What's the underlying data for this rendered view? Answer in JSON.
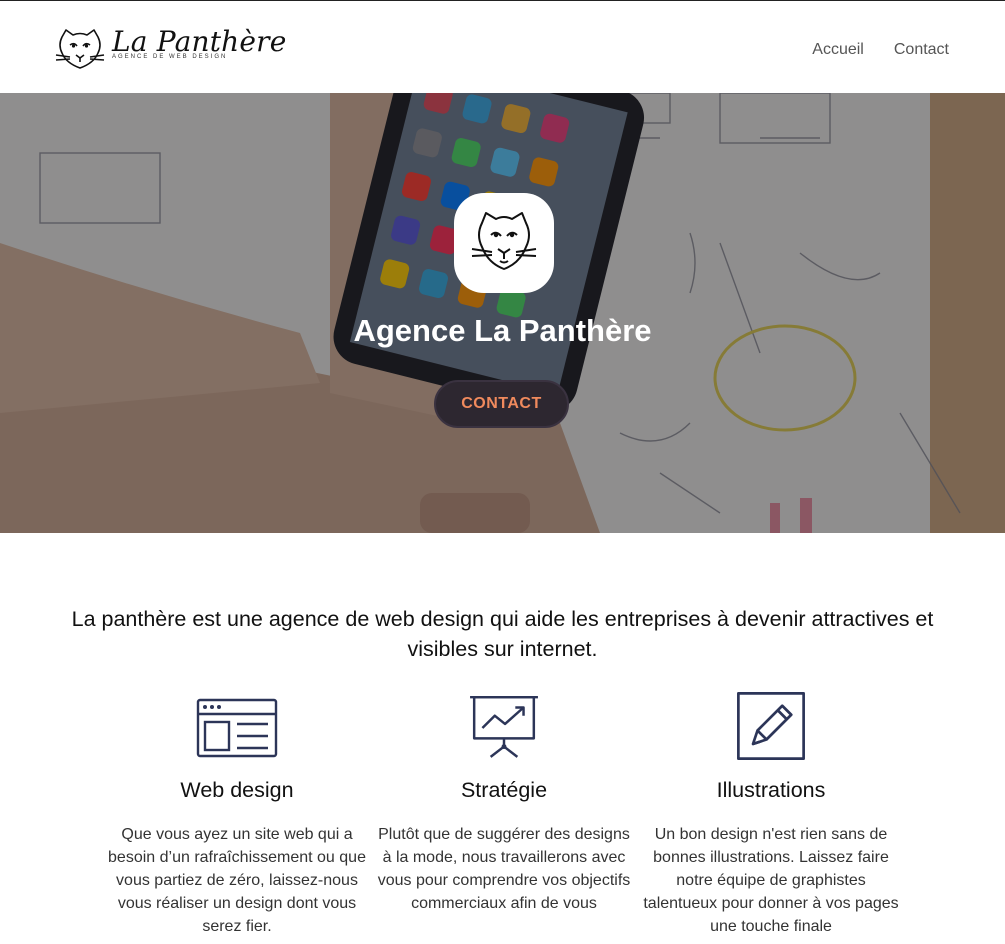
{
  "brand": {
    "name": "La Panthère",
    "tagline": "AGENCE DE WEB DESIGN",
    "logo_icon": "panther-head-icon"
  },
  "nav": {
    "items": [
      {
        "label": "Accueil"
      },
      {
        "label": "Contact"
      }
    ]
  },
  "hero": {
    "badge_icon": "panther-head-icon",
    "title": "Agence La Panthère",
    "button_label": "CONTACT",
    "button_text_color": "#f08a5d",
    "background": "photo-of-hand-with-smartphone-on-sketches"
  },
  "intro": {
    "text": "La panthère est une agence de web design qui aide les entreprises à devenir attractives et visibles sur internet."
  },
  "features": [
    {
      "icon": "browser-window-icon",
      "title": "Web design",
      "text": "Que vous ayez un site web qui a besoin d’un rafraîchissement ou que vous partiez de zéro, laissez-nous vous réaliser un design dont vous serez fier."
    },
    {
      "icon": "presentation-chart-icon",
      "title": "Stratégie",
      "text": "Plutôt que de suggérer des designs à la mode, nous travaillerons avec vous pour comprendre vos objectifs commerciaux afin de vous"
    },
    {
      "icon": "edit-pencil-icon",
      "title": "Illustrations",
      "text": "Un bon design n'est rien sans de bonnes illustrations. Laissez faire notre équipe de graphistes talentueux pour donner à vos pages une touche finale"
    }
  ],
  "colors": {
    "icon_stroke": "#2c3558",
    "accent": "#f08a5d",
    "button_bg": "#2d2730"
  }
}
